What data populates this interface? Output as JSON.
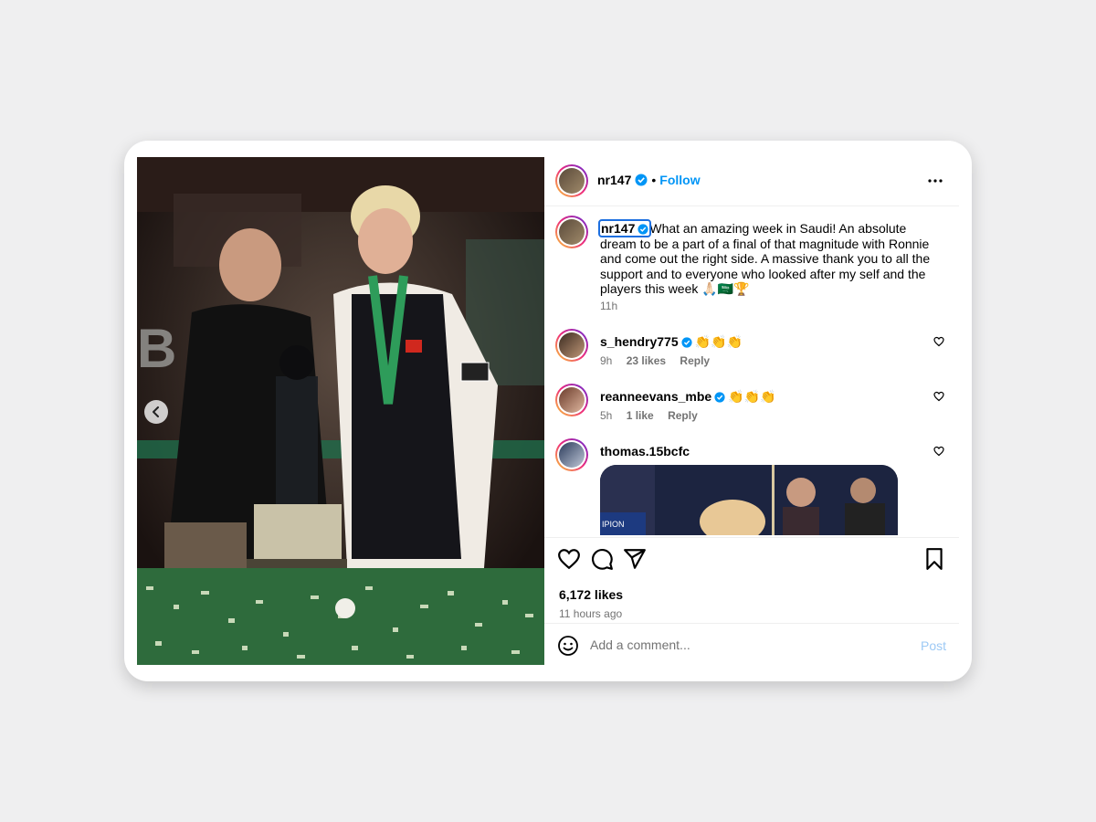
{
  "post": {
    "author": "nr147",
    "follow_label": "Follow",
    "separator": "•"
  },
  "caption": {
    "username": "nr147",
    "text": "What an amazing week in Saudi! An absolute dream to be a part of a final of that magnitude with Ronnie and come out the right side. A massive thank you to all the support and to everyone who looked after my self and the players this week 🙏🏻🇸🇦🏆",
    "time": "11h"
  },
  "comments": [
    {
      "username": "s_hendry775",
      "text": "👏👏👏",
      "time": "9h",
      "likes": "23 likes",
      "reply": "Reply"
    },
    {
      "username": "reanneevans_mbe",
      "text": "👏👏👏",
      "time": "5h",
      "likes": "1 like",
      "reply": "Reply"
    },
    {
      "username": "thomas.15bcfc",
      "text": ""
    }
  ],
  "stats": {
    "likes": "6,172 likes",
    "ago": "11 hours ago"
  },
  "composer": {
    "placeholder": "Add a comment...",
    "post_label": "Post"
  },
  "colors": {
    "accent": "#0095f6",
    "muted": "#737373",
    "post_disabled": "#9cc9f5"
  },
  "icons": [
    "verified-badge-icon",
    "more-icon",
    "heart-icon",
    "comment-icon",
    "share-icon",
    "bookmark-icon",
    "emoji-icon",
    "chevron-left-icon"
  ]
}
